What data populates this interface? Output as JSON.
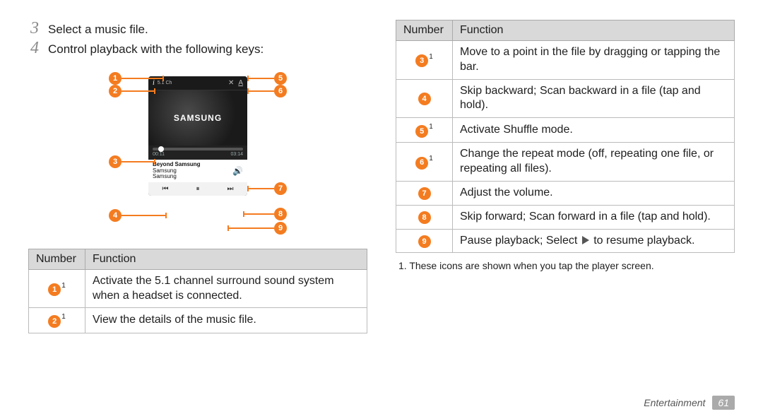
{
  "steps": {
    "s3_num": "3",
    "s3_text": "Select a music file.",
    "s4_num": "4",
    "s4_text": "Control playback with the following keys:"
  },
  "device": {
    "brand": "SAMSUNG",
    "ch_label": "5.1 Ch",
    "time_elapsed": "00:11",
    "time_total": "03:14",
    "track_title": "Beyond Samsung",
    "track_artist": "Samsung",
    "track_album": "Samsung"
  },
  "callouts": {
    "n1": "1",
    "n2": "2",
    "n3": "3",
    "n4": "4",
    "n5": "5",
    "n6": "6",
    "n7": "7",
    "n8": "8",
    "n9": "9"
  },
  "table_headers": {
    "number": "Number",
    "function": "Function"
  },
  "table_left": [
    {
      "n": "1",
      "sup": true,
      "desc": "Activate the 5.1 channel surround sound system when a headset is connected."
    },
    {
      "n": "2",
      "sup": true,
      "desc": "View the details of the music file."
    }
  ],
  "table_right": [
    {
      "n": "3",
      "sup": true,
      "desc": "Move to a point in the file by dragging or tapping the bar."
    },
    {
      "n": "4",
      "sup": false,
      "desc": "Skip backward; Scan backward in a file (tap and hold)."
    },
    {
      "n": "5",
      "sup": true,
      "desc": "Activate Shuffle mode."
    },
    {
      "n": "6",
      "sup": true,
      "desc": "Change the repeat mode (off, repeating one file, or repeating all files)."
    },
    {
      "n": "7",
      "sup": false,
      "desc": "Adjust the volume."
    },
    {
      "n": "8",
      "sup": false,
      "desc": "Skip forward; Scan forward in a file (tap and hold)."
    },
    {
      "n": "9",
      "sup": false,
      "desc_pre": "Pause playback; Select ",
      "desc_post": " to resume playback.",
      "has_icon": true
    }
  ],
  "footnote": "1. These icons are shown when you tap the player screen.",
  "footer": {
    "section": "Entertainment",
    "page": "61"
  }
}
